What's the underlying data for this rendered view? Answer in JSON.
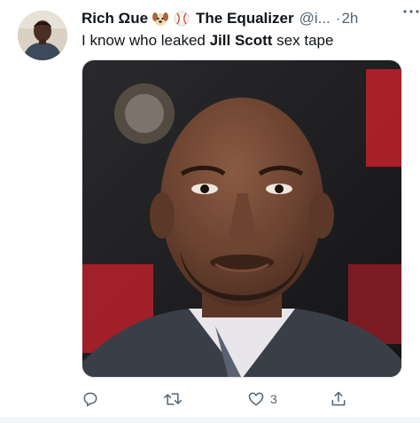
{
  "tweet": {
    "author_name": "Rich Ωue",
    "emojis": [
      "dog-face-icon",
      "baseball-icon"
    ],
    "author_name_2": "The Equalizer",
    "handle": "@i...",
    "separator": "·",
    "time": "2h",
    "text_before": "I know who leaked ",
    "text_bold": "Jill Scott",
    "text_after": " sex tape",
    "actions": {
      "reply_count": "",
      "retweet_count": "",
      "like_count": "3",
      "share_count": ""
    }
  },
  "colors": {
    "text": "#0f1419",
    "muted": "#536471",
    "divider": "#f4f5f6",
    "backdrop_red": "#c5212c"
  }
}
